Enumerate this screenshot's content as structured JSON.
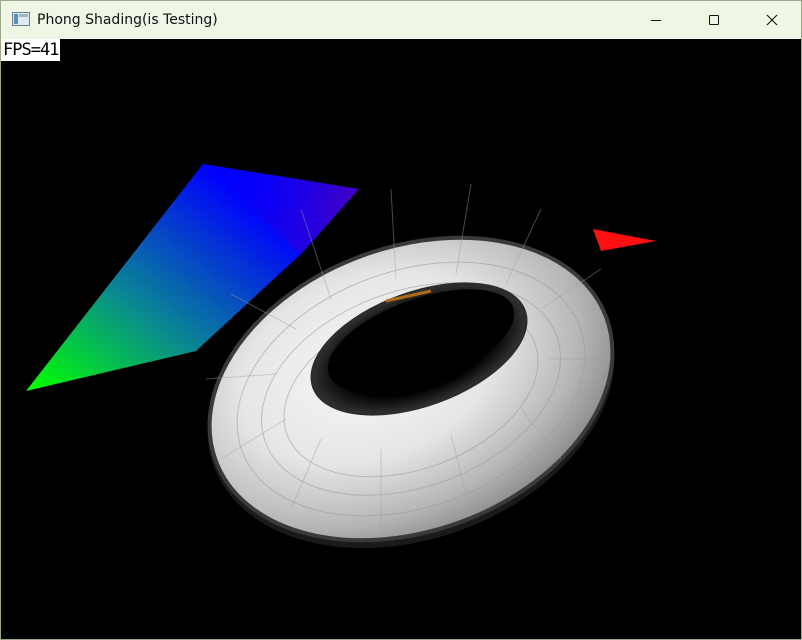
{
  "window": {
    "title": "Phong Shading(is Testing)",
    "icon": "window-app-icon",
    "controls": {
      "minimize": "minimize-icon",
      "maximize": "maximize-icon",
      "close": "close-icon"
    }
  },
  "overlay": {
    "fps_text": "FPS=41"
  },
  "scene": {
    "background": "#000000",
    "plane_colors": {
      "blue": "#0000ff",
      "green": "#00ff00",
      "red": "#ff0000"
    },
    "torus_color": "#e6e6e6"
  }
}
